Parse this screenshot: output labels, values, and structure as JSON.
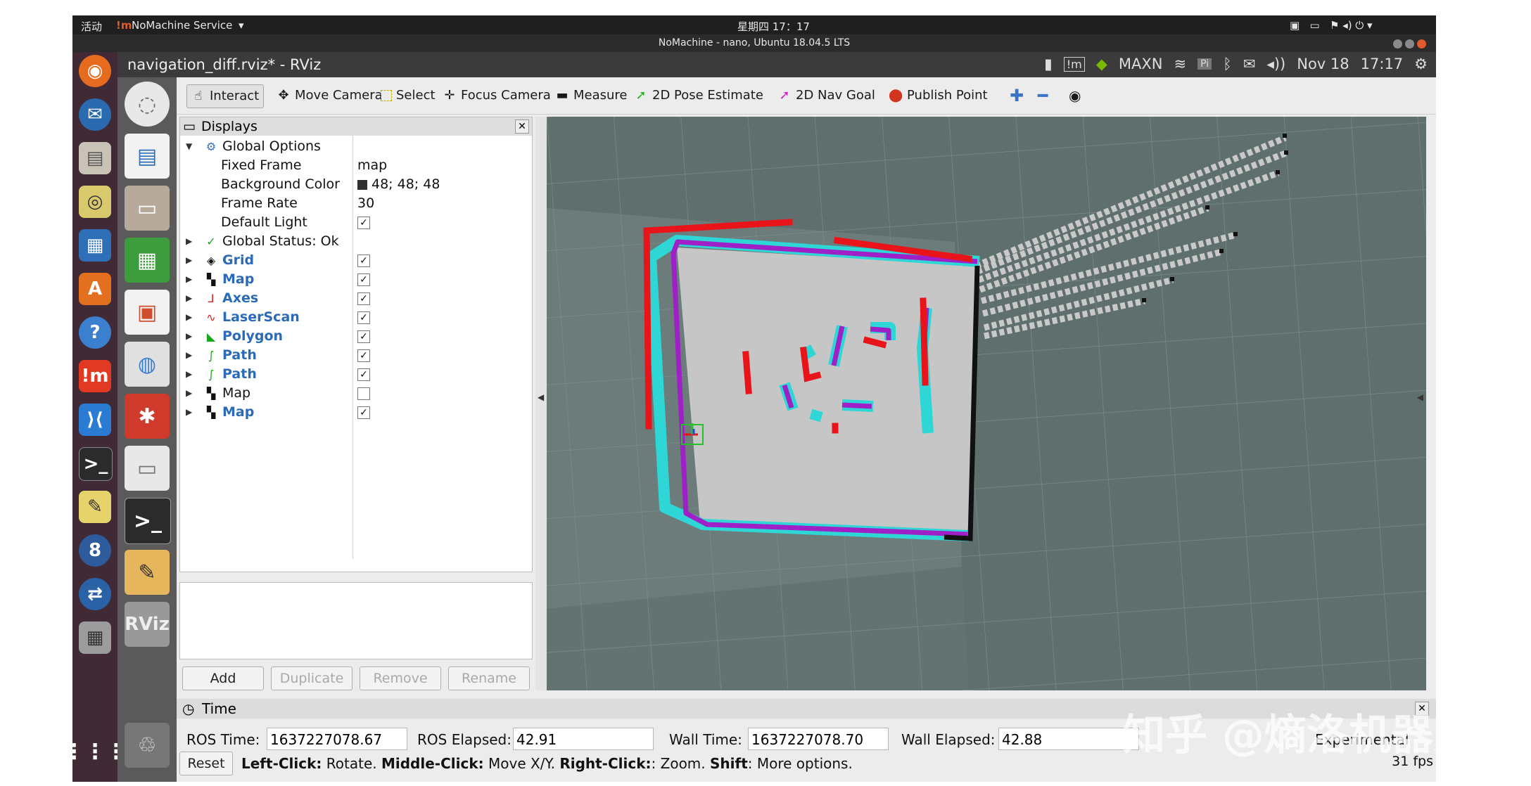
{
  "system": {
    "activities": "活动",
    "app_menu": "NoMachine Service",
    "clock": "星期四 17：17",
    "window_title": "NoMachine - nano, Ubuntu 18.04.5 LTS"
  },
  "rviz": {
    "title": "navigation_diff.rviz* - RViz",
    "tray": {
      "gpu_label": "MAXN",
      "date": "Nov 18",
      "time": "17:17"
    }
  },
  "toolbar": {
    "interact": "Interact",
    "move_camera": "Move Camera",
    "select": "Select",
    "focus_camera": "Focus Camera",
    "measure": "Measure",
    "pose_estimate": "2D Pose Estimate",
    "nav_goal": "2D Nav Goal",
    "publish_point": "Publish Point"
  },
  "displays": {
    "header": "Displays",
    "global_options": "Global Options",
    "properties": [
      {
        "name": "Fixed Frame",
        "value": "map"
      },
      {
        "name": "Background Color",
        "value": "48; 48; 48"
      },
      {
        "name": "Frame Rate",
        "value": "30"
      },
      {
        "name": "Default Light",
        "value": "✓"
      }
    ],
    "global_status": "Global Status: Ok",
    "items": [
      {
        "name": "Grid",
        "checked": "✓"
      },
      {
        "name": "Map",
        "checked": "✓"
      },
      {
        "name": "Axes",
        "checked": "✓"
      },
      {
        "name": "LaserScan",
        "checked": "✓"
      },
      {
        "name": "Polygon",
        "checked": "✓"
      },
      {
        "name": "Path",
        "checked": "✓"
      },
      {
        "name": "Path",
        "checked": "✓"
      },
      {
        "name": "Map",
        "checked": ""
      },
      {
        "name": "Map",
        "checked": "✓"
      }
    ],
    "buttons": {
      "add": "Add",
      "duplicate": "Duplicate",
      "remove": "Remove",
      "rename": "Rename"
    }
  },
  "time": {
    "header": "Time",
    "ros_time_label": "ROS Time:",
    "ros_time": "1637227078.67",
    "ros_elapsed_label": "ROS Elapsed:",
    "ros_elapsed": "42.91",
    "wall_time_label": "Wall Time:",
    "wall_time": "1637227078.70",
    "wall_elapsed_label": "Wall Elapsed:",
    "wall_elapsed": "42.88",
    "experimental": "Experimental"
  },
  "status": {
    "reset": "Reset",
    "left_click": "Left-Click:",
    "left_action": " Rotate. ",
    "middle_click": "Middle-Click:",
    "middle_action": " Move X/Y. ",
    "right_click": "Right-Click:",
    "right_action": ": Zoom. ",
    "shift": "Shift",
    "shift_action": ": More options.",
    "fps": "31 fps"
  },
  "watermark": "知乎 @熵洛机器人",
  "colors": {
    "background_swatch": "#303030",
    "inflation": "#2fd6d6",
    "obstacle": "#a020c8",
    "laser": "#e8141a",
    "map_free": "#c6c6c6"
  }
}
